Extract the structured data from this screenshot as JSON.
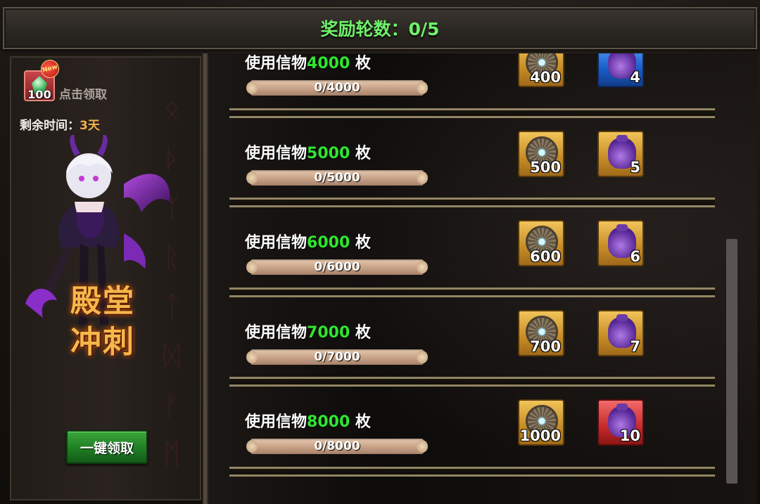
{
  "header": {
    "title": "奖励轮数：0/5"
  },
  "left": {
    "reward_count": "100",
    "new_badge": "New",
    "claim_hint": "点击领取",
    "time_label": "剩余时间：",
    "time_value": "3天",
    "event_title_line1": "殿堂",
    "event_title_line2": "冲刺",
    "claim_all_button": "一键领取"
  },
  "rows": [
    {
      "prefix": "使用信物",
      "amount": "4000",
      "suffix": " 枚",
      "progress": "0/4000",
      "progress_fraction": 0,
      "item1_count": "400",
      "item2_count": "4",
      "item2_rarity": "blue"
    },
    {
      "prefix": "使用信物",
      "amount": "5000",
      "suffix": " 枚",
      "progress": "0/5000",
      "progress_fraction": 0,
      "item1_count": "500",
      "item2_count": "5",
      "item2_rarity": "gold"
    },
    {
      "prefix": "使用信物",
      "amount": "6000",
      "suffix": " 枚",
      "progress": "0/6000",
      "progress_fraction": 0,
      "item1_count": "600",
      "item2_count": "6",
      "item2_rarity": "gold"
    },
    {
      "prefix": "使用信物",
      "amount": "7000",
      "suffix": " 枚",
      "progress": "0/7000",
      "progress_fraction": 0,
      "item1_count": "700",
      "item2_count": "7",
      "item2_rarity": "gold"
    },
    {
      "prefix": "使用信物",
      "amount": "8000",
      "suffix": " 枚",
      "progress": "0/8000",
      "progress_fraction": 0,
      "item1_count": "1000",
      "item2_count": "10",
      "item2_rarity": "red"
    }
  ],
  "colors": {
    "title_green": "#6ff06a",
    "amount_green": "#2ee62e",
    "time_orange": "#f2b24a"
  }
}
